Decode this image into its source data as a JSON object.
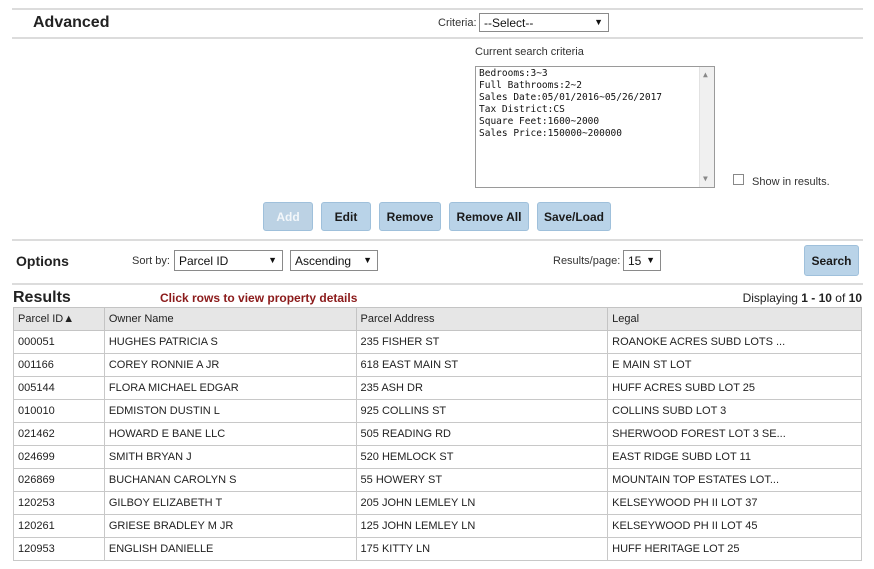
{
  "advanced": {
    "title": "Advanced",
    "criteria_label": "Criteria:",
    "criteria_value": "--Select--",
    "current_label": "Current search criteria",
    "criteria_lines": [
      "Bedrooms:3~3",
      "Full Bathrooms:2~2",
      "Sales Date:05/01/2016~05/26/2017",
      "Tax District:CS",
      "Square Feet:1600~2000",
      "Sales Price:150000~200000"
    ],
    "show_in_results": "Show in results.",
    "buttons": {
      "add": "Add",
      "edit": "Edit",
      "remove": "Remove",
      "remove_all": "Remove All",
      "save_load": "Save/Load"
    }
  },
  "options": {
    "title": "Options",
    "sort_label": "Sort by:",
    "sort_field": "Parcel ID",
    "sort_order": "Ascending",
    "per_page_label": "Results/page:",
    "per_page": "15",
    "search": "Search"
  },
  "results": {
    "title": "Results",
    "hint": "Click rows to view property details",
    "displaying_prefix": "Displaying ",
    "range": "1 - 10",
    "of": " of ",
    "total": "10",
    "columns": [
      "Parcel ID▲",
      "Owner Name",
      "Parcel Address",
      "Legal"
    ],
    "rows": [
      [
        "000051",
        "HUGHES PATRICIA S",
        "235 FISHER ST",
        "ROANOKE ACRES SUBD LOTS ..."
      ],
      [
        "001166",
        "COREY RONNIE A JR",
        "618 EAST MAIN ST",
        "E MAIN ST LOT"
      ],
      [
        "005144",
        "FLORA MICHAEL EDGAR",
        "235 ASH DR",
        "HUFF ACRES SUBD LOT 25"
      ],
      [
        "010010",
        "EDMISTON DUSTIN L",
        "925 COLLINS ST",
        "COLLINS SUBD LOT 3"
      ],
      [
        "021462",
        "HOWARD E BANE LLC",
        "505 READING RD",
        "SHERWOOD FOREST LOT 3 SE..."
      ],
      [
        "024699",
        "SMITH BRYAN J",
        "520 HEMLOCK ST",
        "EAST RIDGE SUBD LOT 11"
      ],
      [
        "026869",
        "BUCHANAN CAROLYN S",
        "55 HOWERY ST",
        "MOUNTAIN TOP ESTATES LOT..."
      ],
      [
        "120253",
        "GILBOY ELIZABETH T",
        "205 JOHN LEMLEY LN",
        "KELSEYWOOD PH II LOT 37"
      ],
      [
        "120261",
        "GRIESE BRADLEY M JR",
        "125 JOHN LEMLEY LN",
        "KELSEYWOOD PH II LOT 45"
      ],
      [
        "120953",
        "ENGLISH DANIELLE",
        "175 KITTY LN",
        "HUFF HERITAGE LOT 25"
      ]
    ]
  },
  "colors": {
    "button_bg": "#b9d3e8",
    "hint": "#8b1a1a",
    "header_bg": "#e6e6e6"
  }
}
